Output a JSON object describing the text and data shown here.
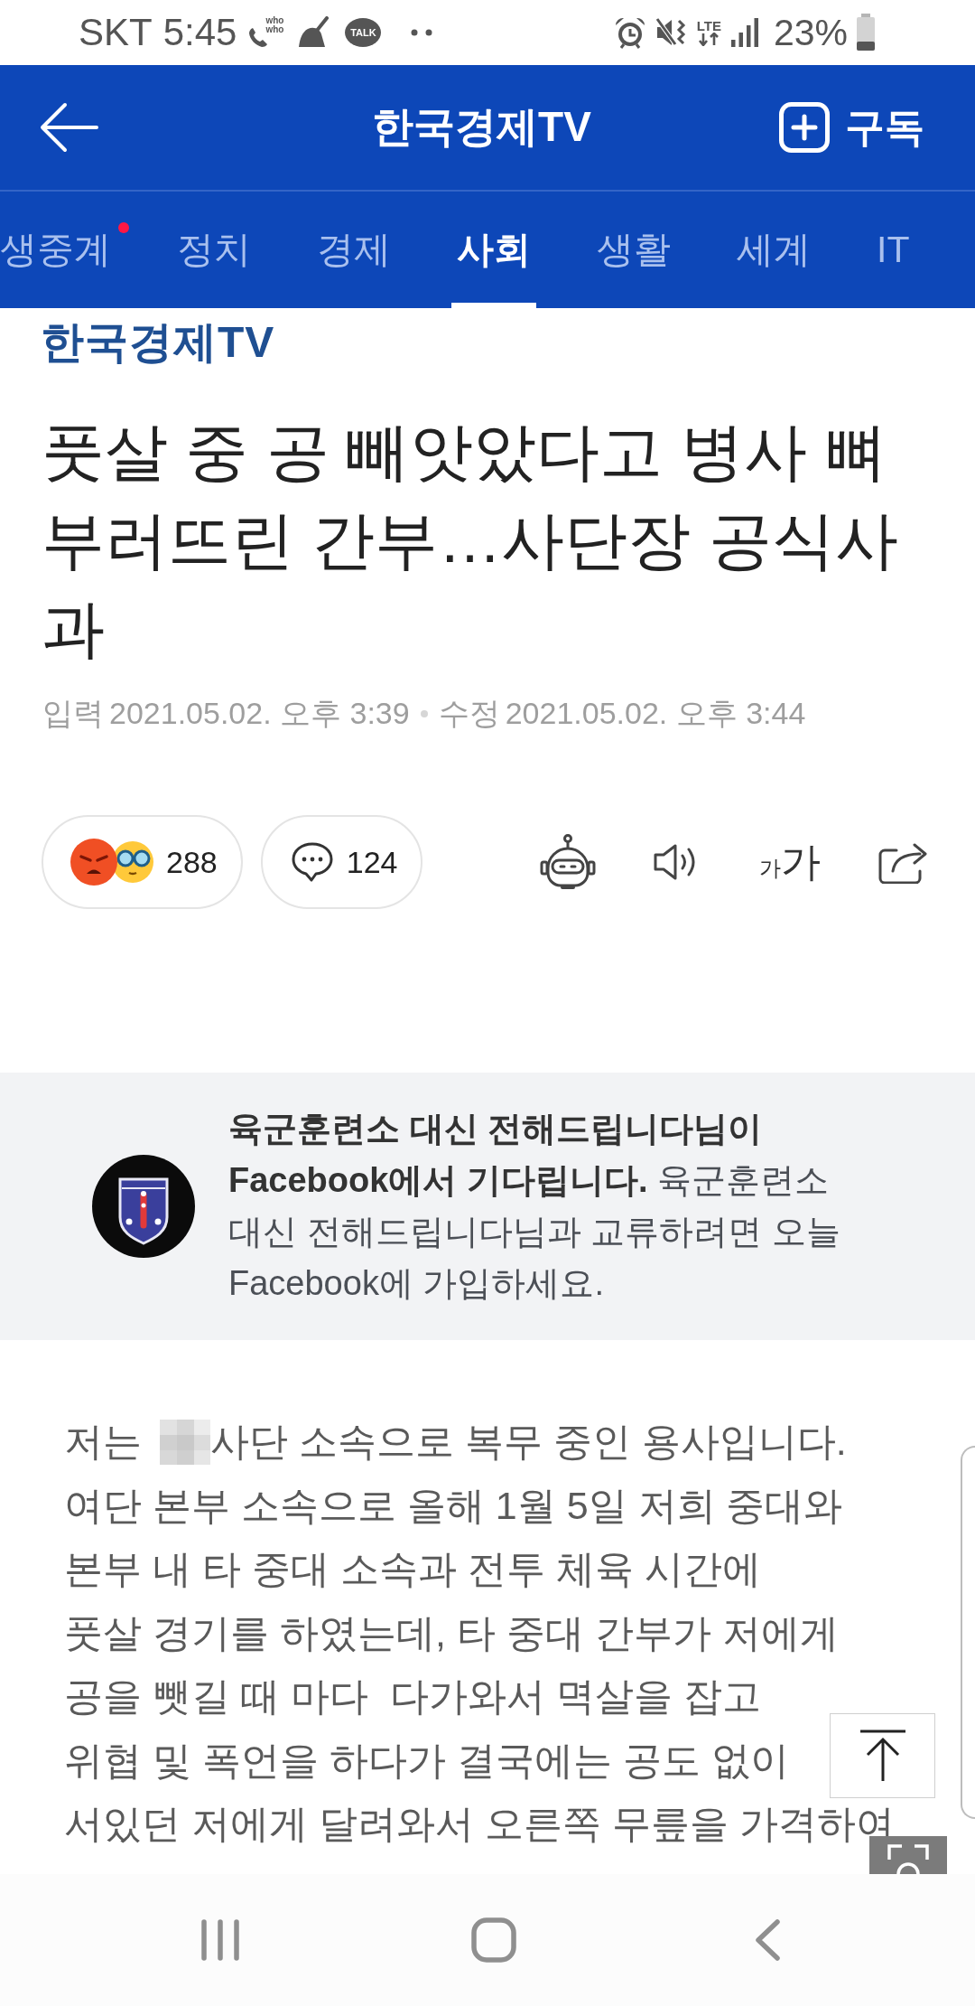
{
  "status_bar": {
    "carrier": "SKT",
    "time": "5:45",
    "caller_app_label": [
      "who",
      "who"
    ],
    "chat_app_label": "TALK",
    "network_type": "LTE",
    "battery_percent": "23%"
  },
  "app_bar": {
    "title": "한국경제TV",
    "subscribe_label": "구독"
  },
  "tabs": [
    {
      "label": "생중계",
      "selected": false,
      "has_new": true
    },
    {
      "label": "정치",
      "selected": false,
      "has_new": false
    },
    {
      "label": "경제",
      "selected": false,
      "has_new": false
    },
    {
      "label": "사회",
      "selected": true,
      "has_new": false
    },
    {
      "label": "생활",
      "selected": false,
      "has_new": false
    },
    {
      "label": "세계",
      "selected": false,
      "has_new": false
    },
    {
      "label": "IT",
      "selected": false,
      "has_new": false
    }
  ],
  "article": {
    "source_logo": "한국경제TV",
    "headline": "풋살 중 공 빼앗았다고 병사 뼈 부러뜨린 간부…사단장 공식사과",
    "timestamps": [
      {
        "label": "입력",
        "time": "2021.05.02. 오후 3:39"
      },
      {
        "label": "수정",
        "time": "2021.05.02. 오후 3:44"
      }
    ],
    "reaction_count": "288",
    "comment_count": "124",
    "text_size_button": {
      "small": "가",
      "large": "가"
    }
  },
  "facebook_embed": {
    "message": "**육군훈련소 대신 전해드립니다님이 Facebook에서 기다립니다.** 육군훈련소 대신 전해드립니다님과 교류하려면 오늘 Facebook에 가입하세요."
  },
  "post_image": {
    "lines": [
      {
        "kind": "redacted",
        "before": "저는",
        "after": "사단 소속으로 복무 중인 용사입니다."
      },
      {
        "kind": "plain",
        "text": "여단 본부 소속으로 올해 1월 5일 저희 중대와"
      },
      {
        "kind": "plain",
        "text": "본부 내 타 중대 소속과 전투 체육 시간에"
      },
      {
        "kind": "plain",
        "text": "풋살 경기를 하였는데, 타 중대 간부가 저에게"
      },
      {
        "kind": "plain",
        "text": "공을 뺏길 때 마다  다가와서 멱살을 잡고"
      },
      {
        "kind": "plain",
        "text": "위협 및 폭언을 하다가 결국에는 공도 없이"
      },
      {
        "kind": "plain",
        "text": "서있던 저에게 달려와서 오른쪽 무릎을 가격하여"
      }
    ]
  }
}
